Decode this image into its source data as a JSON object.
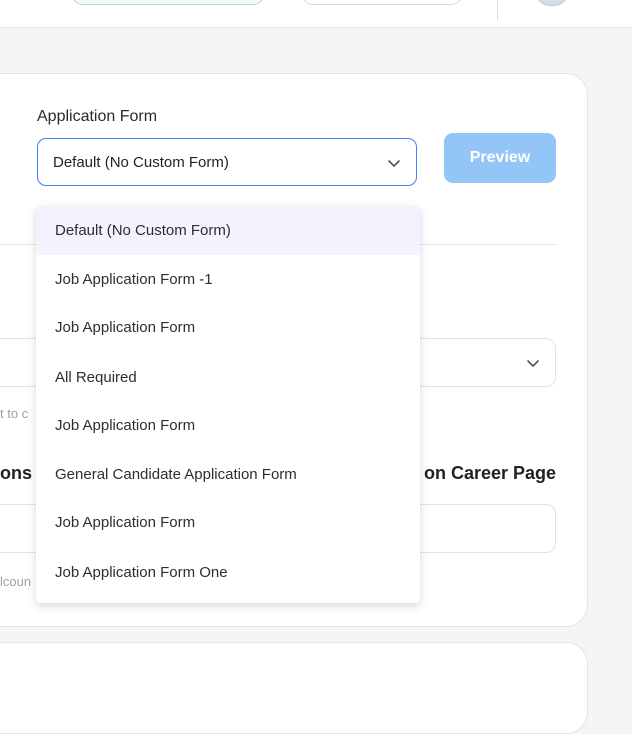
{
  "application_form": {
    "label": "Application Form",
    "selected_value": "Default (No Custom Form)",
    "preview_label": "Preview"
  },
  "background": {
    "hint_text_1": "t to c",
    "section_left_label": "ons",
    "section_right_label": "on Career Page",
    "hint_text_2": "lcoun"
  },
  "dropdown": {
    "options": [
      "Default (No Custom Form)",
      "Job Application Form -1",
      "Job Application Form",
      "All Required",
      "Job Application Form",
      "General Candidate Application Form",
      "Job Application Form",
      "Job Application Form One"
    ],
    "selected_index": 0
  },
  "colors": {
    "focus_border": "#3b82f6",
    "preview_button_bg": "#93c5f7",
    "selected_option_bg": "#f3f3fd"
  },
  "icons": {
    "select_chevron": "chevron-down-icon"
  }
}
